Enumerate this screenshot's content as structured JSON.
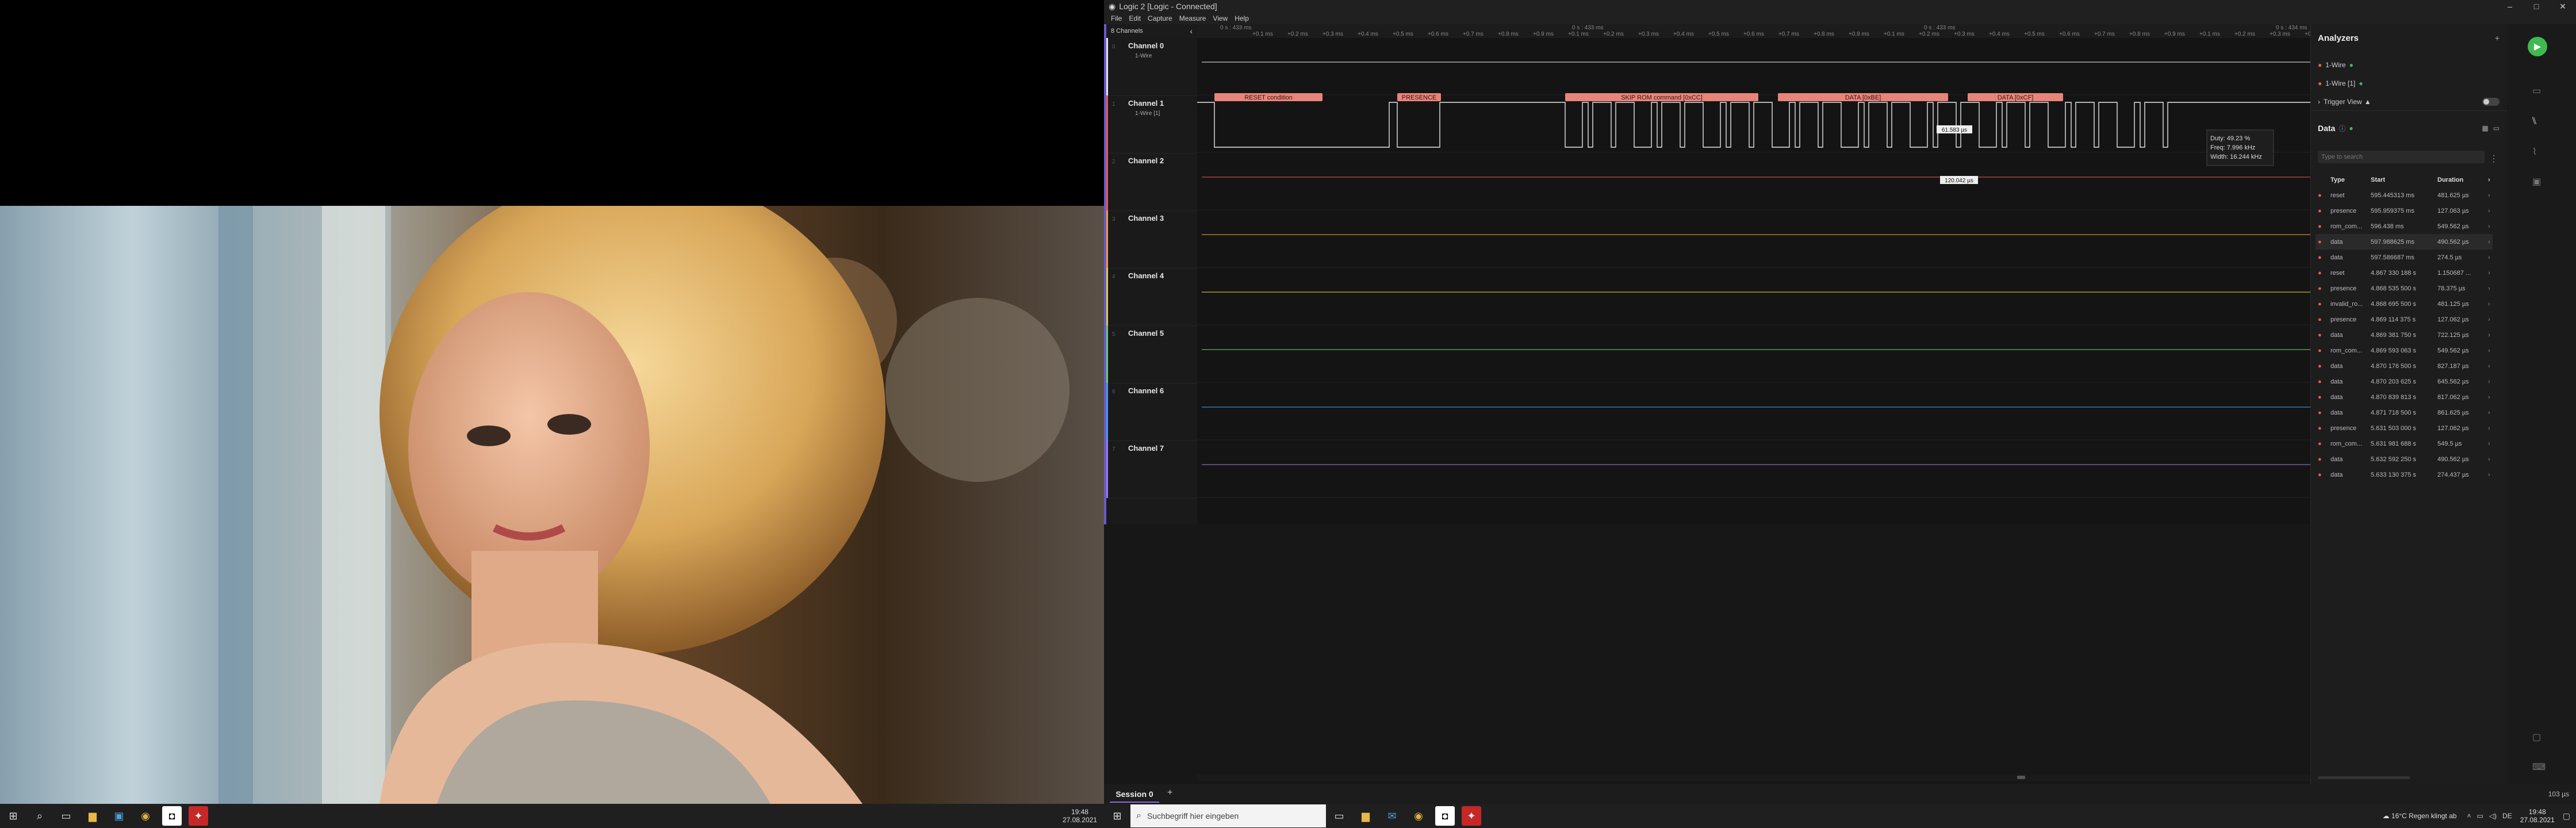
{
  "app": {
    "title": "Logic 2 [Logic - Connected]",
    "window_controls": [
      "–",
      "□",
      "✕"
    ],
    "menu": [
      "File",
      "Edit",
      "Capture",
      "Measure",
      "View",
      "Help"
    ]
  },
  "channels_header": "8 Channels",
  "channels": [
    {
      "index": "0",
      "name": "Channel 0",
      "sub": "1-Wire",
      "color": "#e6e6e6"
    },
    {
      "index": "1",
      "name": "Channel 1",
      "sub": "1-Wire [1]",
      "color": "#e85a4f"
    },
    {
      "index": "2",
      "name": "Channel 2",
      "sub": "",
      "color": "#e85a4f"
    },
    {
      "index": "3",
      "name": "Channel 3",
      "sub": "",
      "color": "#f0a040"
    },
    {
      "index": "4",
      "name": "Channel 4",
      "sub": "",
      "color": "#e0d040"
    },
    {
      "index": "5",
      "name": "Channel 5",
      "sub": "",
      "color": "#6ad06a"
    },
    {
      "index": "6",
      "name": "Channel 6",
      "sub": "",
      "color": "#4a9ee0"
    },
    {
      "index": "7",
      "name": "Channel 7",
      "sub": "",
      "color": "#9a7ae0"
    }
  ],
  "timeline": {
    "group_labels": [
      "0 s : 433 ms",
      "0 s : 433 ms",
      "0 s : 433 ms",
      "0 s : 434 ms"
    ],
    "ticks": [
      "+0.1 ms",
      "+0.2 ms",
      "+0.3 ms",
      "+0.4 ms",
      "+0.5 ms",
      "+0.6 ms",
      "+0.7 ms",
      "+0.8 ms",
      "+0.9 ms",
      "+0.1 ms",
      "+0.2 ms",
      "+0.3 ms",
      "+0.4 ms",
      "+0.5 ms",
      "+0.6 ms",
      "+0.7 ms",
      "+0.8 ms",
      "+0.9 ms",
      "+0.1 ms",
      "+0.2 ms",
      "+0.3 ms",
      "+0.4 ms",
      "+0.5 ms",
      "+0.6 ms",
      "+0.7 ms",
      "+0.8 ms",
      "+0.9 ms",
      "+0.1 ms",
      "+0.2 ms",
      "+0.3 ms",
      "+0.4 ms"
    ]
  },
  "decoded": [
    {
      "label": "RESET condition"
    },
    {
      "label": "PRESENCE"
    },
    {
      "label": "SKIP ROM command [0xCC]"
    },
    {
      "label": "DATA [0xBE]"
    },
    {
      "label": "DATA [0xCF]"
    }
  ],
  "measurements": {
    "pulse_width": "61.583 µs",
    "interval": "120.042 µs",
    "tooltip": [
      "Duty: 49.23 %",
      "Freq: 7.996 kHz",
      "Width: 16.244 kHz"
    ]
  },
  "analyzers": {
    "title": "Analyzers",
    "items": [
      "1-Wire",
      "1-Wire [1]"
    ],
    "trigger_view": "Trigger View",
    "data_title": "Data",
    "search_placeholder": "Type to search",
    "columns": [
      "Type",
      "Start",
      "Duration"
    ],
    "rows": [
      {
        "type": "reset",
        "start": "595.445313 ms",
        "duration": "481.625 µs",
        "color": "#e85a4f"
      },
      {
        "type": "presence",
        "start": "595.959375 ms",
        "duration": "127.063 µs",
        "color": "#e85a4f"
      },
      {
        "type": "rom_com...",
        "start": "596.438 ms",
        "duration": "549.562 µs",
        "color": "#e85a4f"
      },
      {
        "type": "data",
        "start": "597.988625 ms",
        "duration": "490.562 µs",
        "color": "#e85a4f"
      },
      {
        "type": "data",
        "start": "597.586687 ms",
        "duration": "274.5 µs",
        "color": "#e85a4f"
      },
      {
        "type": "reset",
        "start": "4.867 330 188 s",
        "duration": "1.150687 ...",
        "color": "#e85a4f"
      },
      {
        "type": "presence",
        "start": "4.868 535 500 s",
        "duration": "78.375 µs",
        "color": "#e85a4f"
      },
      {
        "type": "invalid_ro...",
        "start": "4.868 695 500 s",
        "duration": "481.125 µs",
        "color": "#e85a4f"
      },
      {
        "type": "presence",
        "start": "4.869 114 375 s",
        "duration": "127.062 µs",
        "color": "#e85a4f"
      },
      {
        "type": "data",
        "start": "4.869 381 750 s",
        "duration": "722.125 µs",
        "color": "#e85a4f"
      },
      {
        "type": "rom_com...",
        "start": "4.869 593 063 s",
        "duration": "549.562 µs",
        "color": "#e85a4f"
      },
      {
        "type": "data",
        "start": "4.870 176 500 s",
        "duration": "827.187 µs",
        "color": "#e85a4f"
      },
      {
        "type": "data",
        "start": "4.870 203 625 s",
        "duration": "645.562 µs",
        "color": "#e85a4f"
      },
      {
        "type": "data",
        "start": "4.870 839 813 s",
        "duration": "817.062 µs",
        "color": "#e85a4f"
      },
      {
        "type": "data",
        "start": "4.871 718 500 s",
        "duration": "861.625 µs",
        "color": "#e85a4f"
      },
      {
        "type": "presence",
        "start": "5.631 503 000 s",
        "duration": "127.062 µs",
        "color": "#e85a4f"
      },
      {
        "type": "rom_com...",
        "start": "5.631 981 688 s",
        "duration": "549.5 µs",
        "color": "#e85a4f"
      },
      {
        "type": "data",
        "start": "5.632 592 250 s",
        "duration": "490.562 µs",
        "color": "#e85a4f"
      },
      {
        "type": "data",
        "start": "5.633 130 375 s",
        "duration": "274.437 µs",
        "color": "#e85a4f"
      }
    ]
  },
  "session": {
    "tab": "Session 0",
    "add": "+",
    "time": "103 µs"
  },
  "taskbar_right": {
    "search_placeholder": "Suchbegriff hier eingeben",
    "weather": "16°C  Regen klingt ab",
    "lang": "DE",
    "time": "19:48",
    "date": "27.08.2021"
  },
  "taskbar_left": {
    "time": "19:48",
    "date": "27.08.2021"
  }
}
